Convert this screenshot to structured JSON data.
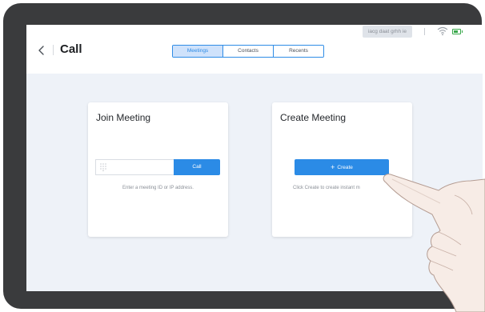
{
  "status_bar": {
    "info_text": "iacg daat grhh ie",
    "wifi_icon": "wifi-icon",
    "battery_icon": "battery-icon",
    "battery_color": "#39a84b"
  },
  "header": {
    "back_icon": "chevron-left-icon",
    "title": "Call"
  },
  "tabs": [
    {
      "label": "Meetings",
      "active": true
    },
    {
      "label": "Contacts",
      "active": false
    },
    {
      "label": "Recents",
      "active": false
    }
  ],
  "join_meeting": {
    "title": "Join Meeting",
    "input_icon": "keypad-icon",
    "input_placeholder": "",
    "call_label": "Call",
    "hint": "Enter a meeting ID or IP address."
  },
  "create_meeting": {
    "title": "Create Meeting",
    "create_icon": "plus-icon",
    "create_label": "Create",
    "hint": "Click Create to create instant m"
  },
  "colors": {
    "accent": "#2b8be6",
    "bezel": "#3a3b3d",
    "screen_bg": "#eef2f8"
  }
}
